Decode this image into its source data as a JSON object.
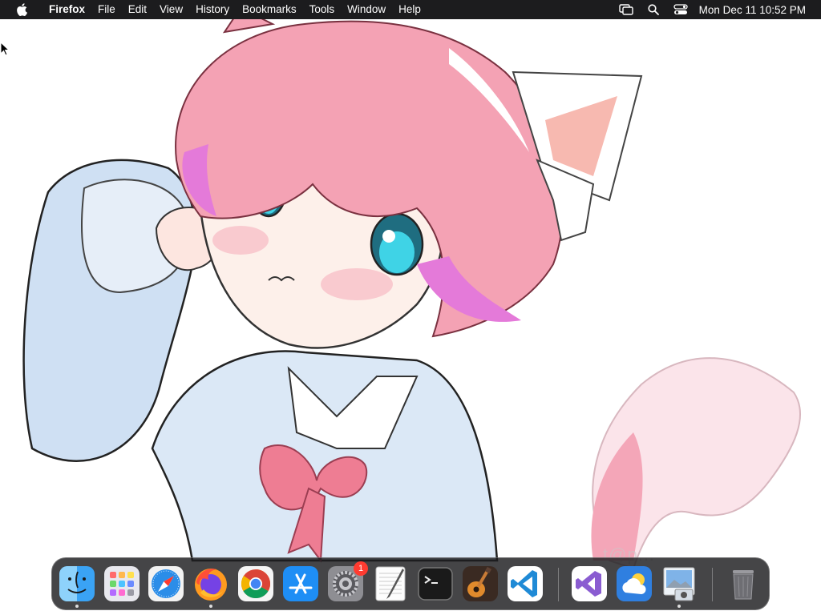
{
  "menubar": {
    "app_name": "Firefox",
    "items": [
      "File",
      "Edit",
      "View",
      "History",
      "Bookmarks",
      "Tools",
      "Window",
      "Help"
    ],
    "clock": "Mon Dec 11  10:52 PM"
  },
  "dock": {
    "apps": [
      {
        "name": "Finder",
        "running": true
      },
      {
        "name": "Launchpad",
        "running": false
      },
      {
        "name": "Safari",
        "running": false
      },
      {
        "name": "Firefox",
        "running": true
      },
      {
        "name": "Google Chrome",
        "running": false
      },
      {
        "name": "App Store",
        "running": false
      },
      {
        "name": "System Settings",
        "running": false,
        "badge": "1"
      },
      {
        "name": "TextEdit",
        "running": false
      },
      {
        "name": "Terminal",
        "running": false
      },
      {
        "name": "GarageBand",
        "running": false
      },
      {
        "name": "Visual Studio Code",
        "running": false
      },
      {
        "name": "Visual Studio",
        "running": false
      },
      {
        "name": "Weather",
        "running": false
      },
      {
        "name": "Preview",
        "running": true
      },
      {
        "name": "Trash",
        "running": false
      }
    ]
  },
  "wallpaper": {
    "description_icon": "anime-catgirl-wallpaper",
    "watermark": "t@p..."
  }
}
